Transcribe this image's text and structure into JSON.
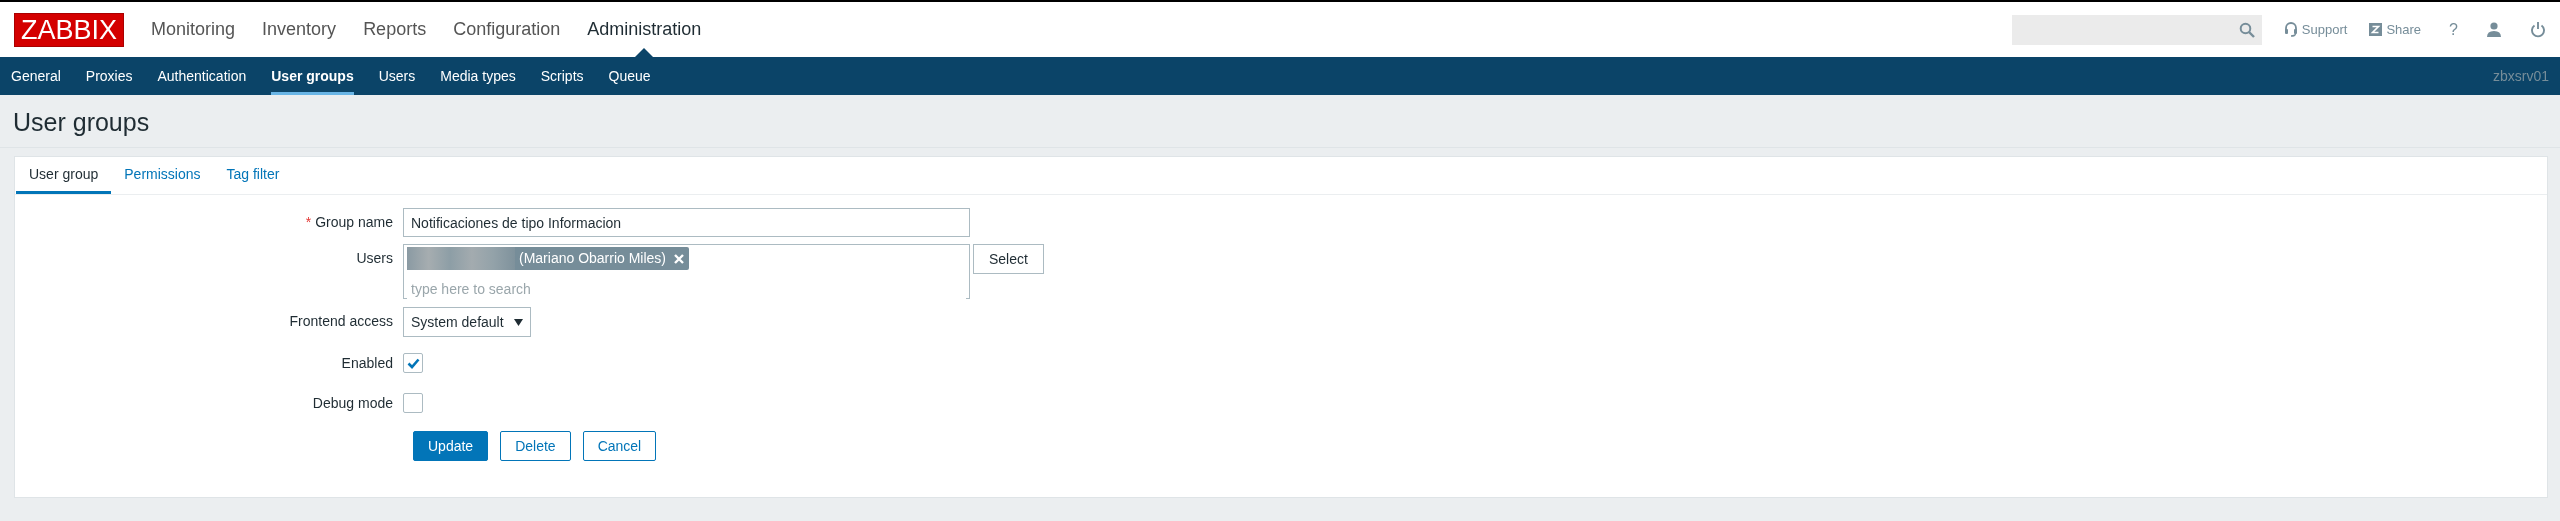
{
  "logo": "ZABBIX",
  "main_menu": [
    {
      "label": "Monitoring",
      "selected": false
    },
    {
      "label": "Inventory",
      "selected": false
    },
    {
      "label": "Reports",
      "selected": false
    },
    {
      "label": "Configuration",
      "selected": false
    },
    {
      "label": "Administration",
      "selected": true
    }
  ],
  "header_links": [
    {
      "kind": "support",
      "label": "Support"
    },
    {
      "kind": "share",
      "label": "Share"
    },
    {
      "kind": "help",
      "label": "?"
    },
    {
      "kind": "profile"
    },
    {
      "kind": "logout"
    }
  ],
  "sub_menu": [
    {
      "label": "General",
      "selected": false
    },
    {
      "label": "Proxies",
      "selected": false
    },
    {
      "label": "Authentication",
      "selected": false
    },
    {
      "label": "User groups",
      "selected": true
    },
    {
      "label": "Users",
      "selected": false
    },
    {
      "label": "Media types",
      "selected": false
    },
    {
      "label": "Scripts",
      "selected": false
    },
    {
      "label": "Queue",
      "selected": false
    }
  ],
  "server_name": "zbxsrv01",
  "page_title": "User groups",
  "tabs": [
    {
      "label": "User group",
      "selected": true
    },
    {
      "label": "Permissions",
      "selected": false
    },
    {
      "label": "Tag filter",
      "selected": false
    }
  ],
  "form": {
    "group_name": {
      "label": "Group name",
      "required_mark": "*",
      "value": "Notificaciones de tipo Informacion"
    },
    "users": {
      "label": "Users",
      "chips": [
        {
          "text": "(Mariano Obarrio Miles)",
          "redacted": true
        }
      ],
      "placeholder": "type here to search",
      "button": "Select"
    },
    "frontend_access": {
      "label": "Frontend access",
      "value": "System default"
    },
    "checkboxes": [
      {
        "label": "Enabled",
        "checked": true
      },
      {
        "label": "Debug mode",
        "checked": false
      }
    ],
    "buttons": [
      {
        "label": "Update",
        "kind": "primary"
      },
      {
        "label": "Delete",
        "kind": "secondary"
      },
      {
        "label": "Cancel",
        "kind": "secondary"
      }
    ]
  }
}
